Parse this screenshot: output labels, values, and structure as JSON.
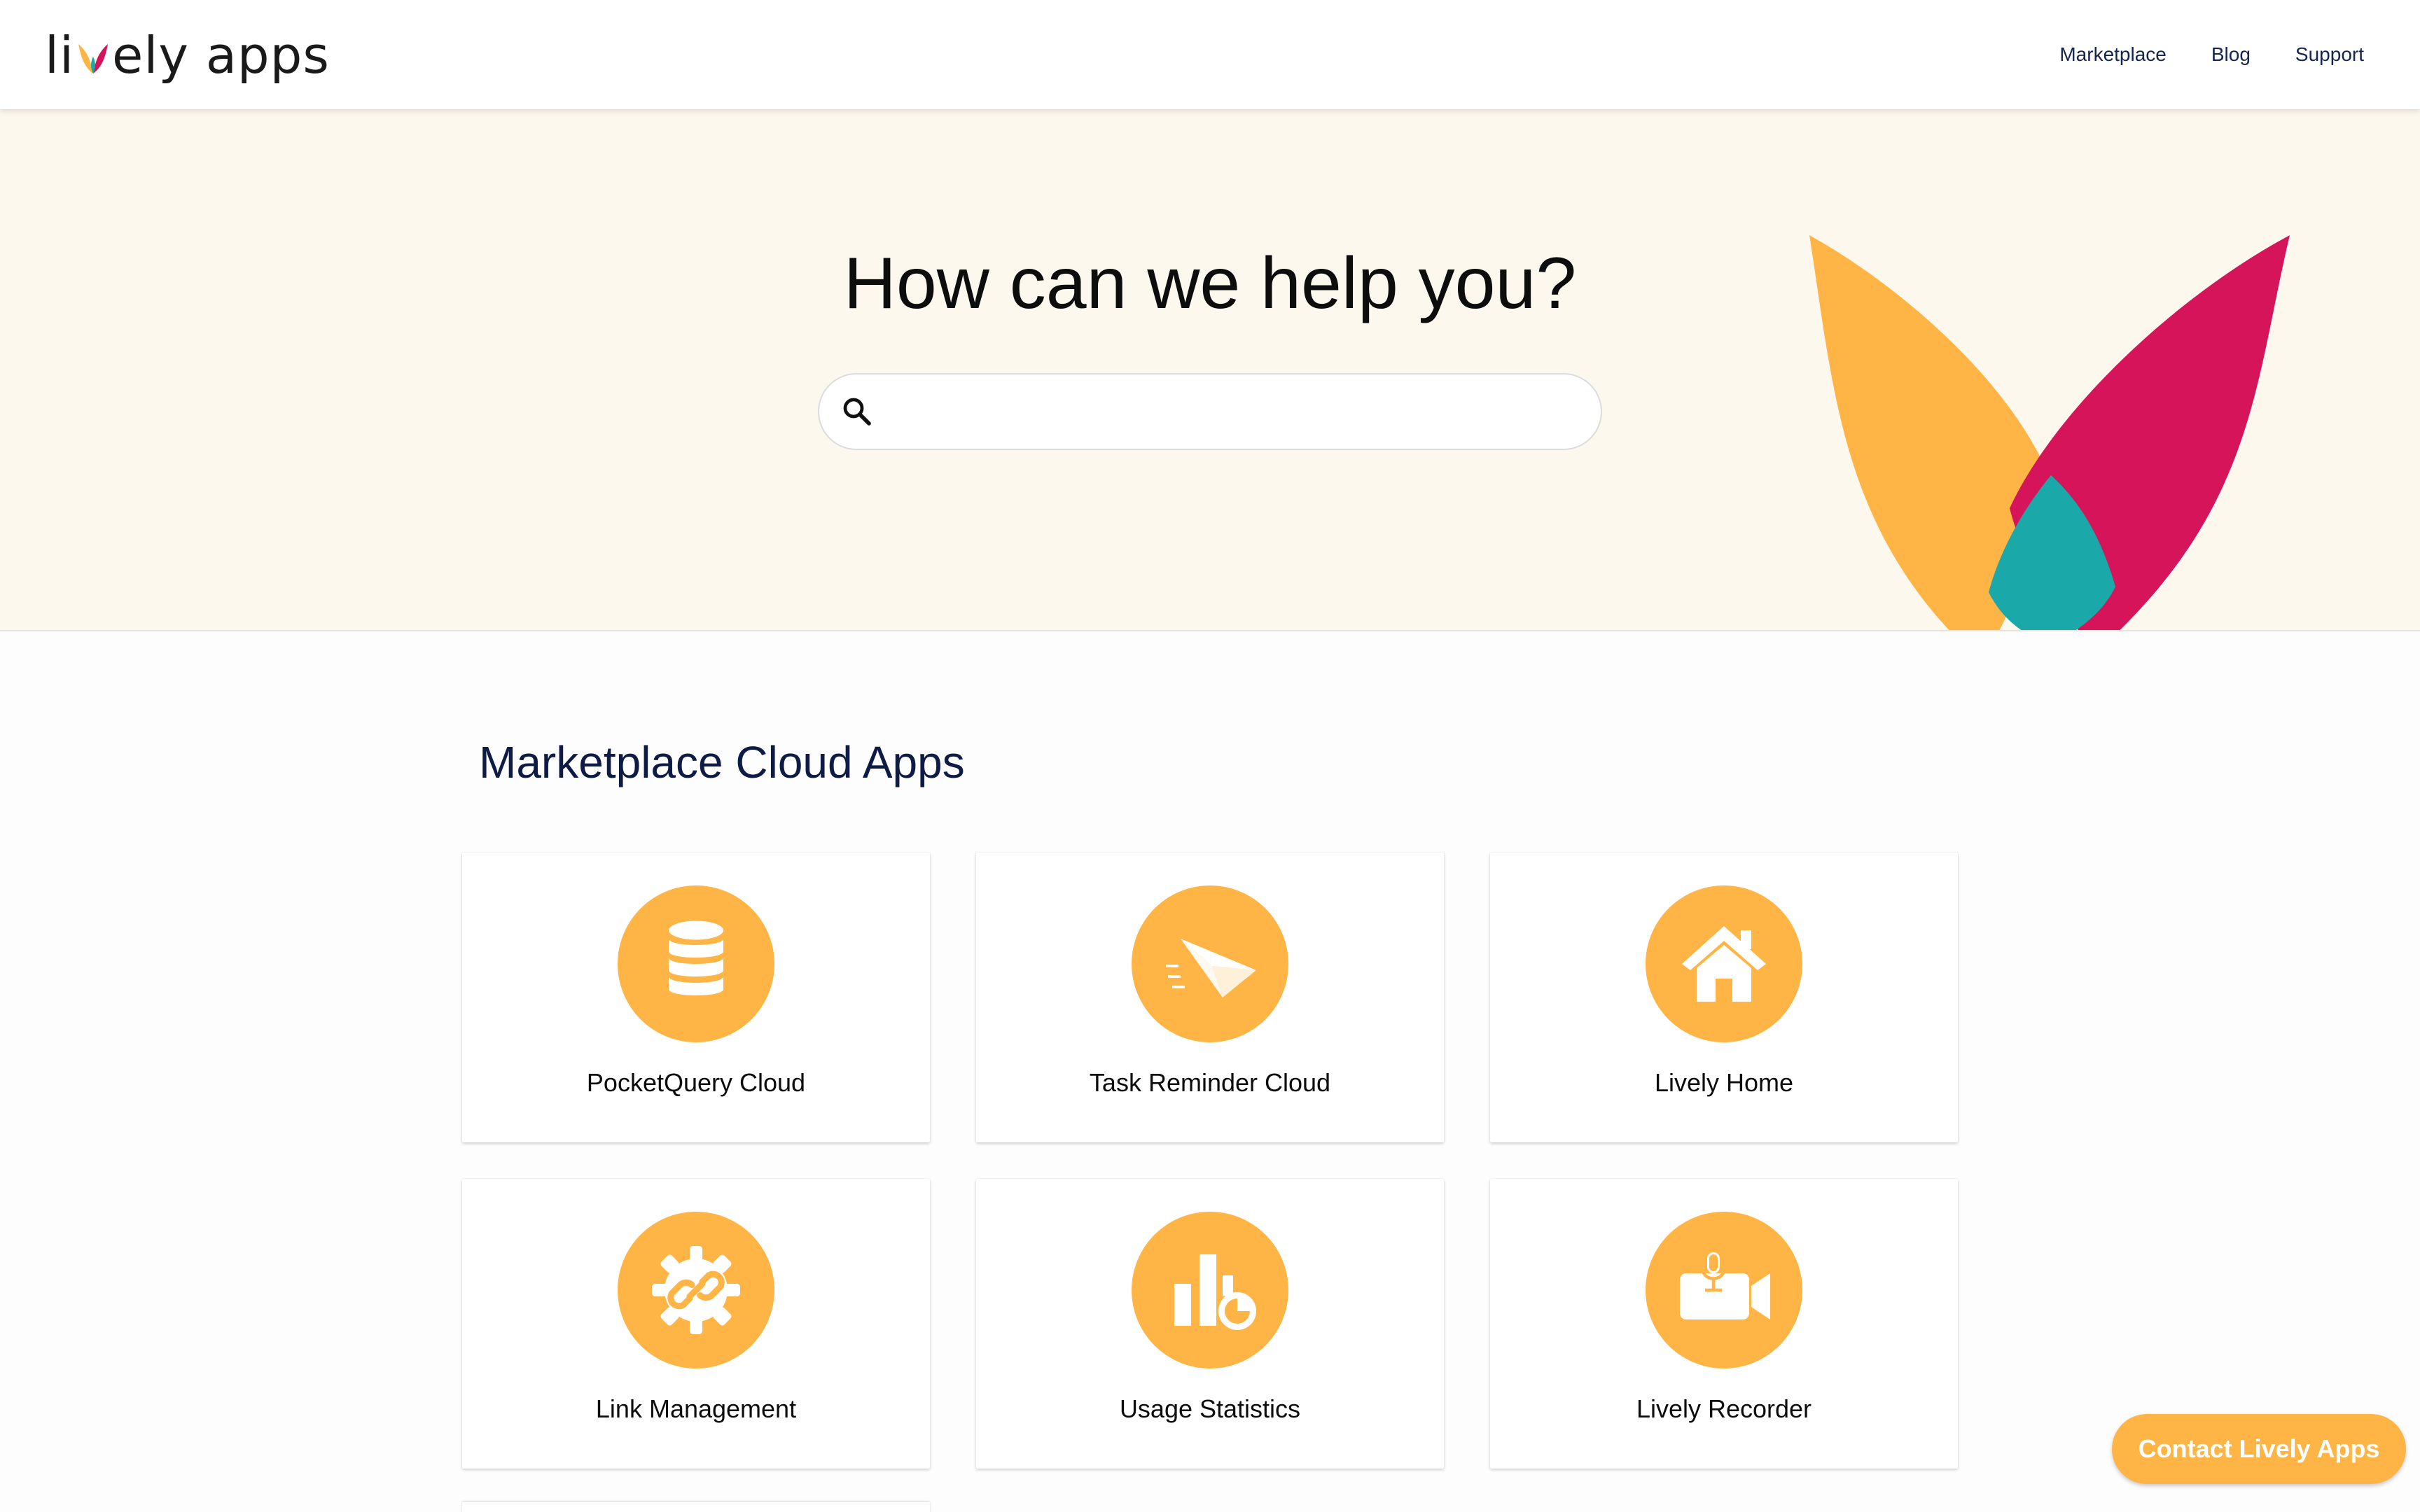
{
  "header": {
    "logo_part_a": "li",
    "logo_part_b": "ely apps",
    "nav": [
      {
        "label": "Marketplace"
      },
      {
        "label": "Blog"
      },
      {
        "label": "Support"
      }
    ]
  },
  "hero": {
    "title": "How can we help you?",
    "search": {
      "value": "",
      "placeholder": ""
    }
  },
  "section": {
    "title": "Marketplace Cloud Apps",
    "apps": [
      {
        "name": "PocketQuery Cloud",
        "icon": "database-icon"
      },
      {
        "name": "Task Reminder Cloud",
        "icon": "paper-plane-icon"
      },
      {
        "name": "Lively Home",
        "icon": "house-icon"
      },
      {
        "name": "Link Management",
        "icon": "gear-link-icon"
      },
      {
        "name": "Usage Statistics",
        "icon": "bar-chart-icon"
      },
      {
        "name": "Lively Recorder",
        "icon": "video-mic-icon"
      }
    ]
  },
  "contact": {
    "label": "Contact Lively Apps"
  },
  "colors": {
    "accent": "#ffb545",
    "hero_bg": "#fdf8ee",
    "leaf_yellow": "#ffb545",
    "leaf_pink": "#d6145a",
    "leaf_teal": "#1aa9a8",
    "nav_text": "#15254d"
  }
}
